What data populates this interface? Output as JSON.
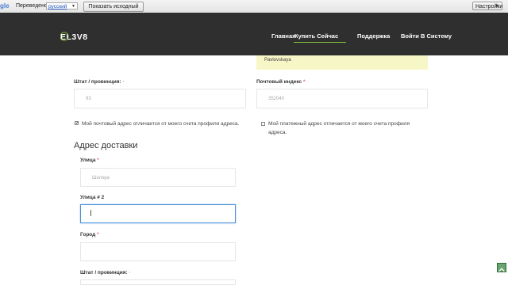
{
  "translate_bar": {
    "logo_text": "gle",
    "translated_text": "Переведено на",
    "language": "русский",
    "show_original_label": "Показать исходный текст",
    "options_label": "Настройки"
  },
  "header": {
    "logo": "EL3V8",
    "nav": [
      "Главная",
      "Купить Сейчас",
      "Поддержка",
      "Войти В Систему"
    ],
    "active_nav": "Купить Сейчас",
    "accent_color": "#7cbb3b"
  },
  "notice": {
    "value": "Pavlovskaya"
  },
  "billing": {
    "state_label": "Штат / провинция:",
    "state_value": "93",
    "zip_label": "Почтовый индекс",
    "zip_value": "352040",
    "checkbox_same_mailing": {
      "label": "Мой почтовый адрес отличается от моего счета профиля адреса.",
      "checked": true
    },
    "checkbox_same_billing": {
      "label": "Мой платежный адрес отличается от моего счета профиля адреса.",
      "checked": false
    }
  },
  "shipping": {
    "title": "Адрес доставки",
    "street_label": "Улица",
    "street_value": "Шилауа",
    "street2_label": "Улица # 2",
    "street2_value": "",
    "city_label": "Город",
    "city_value": "",
    "state_label": "Штат / провинция:"
  }
}
